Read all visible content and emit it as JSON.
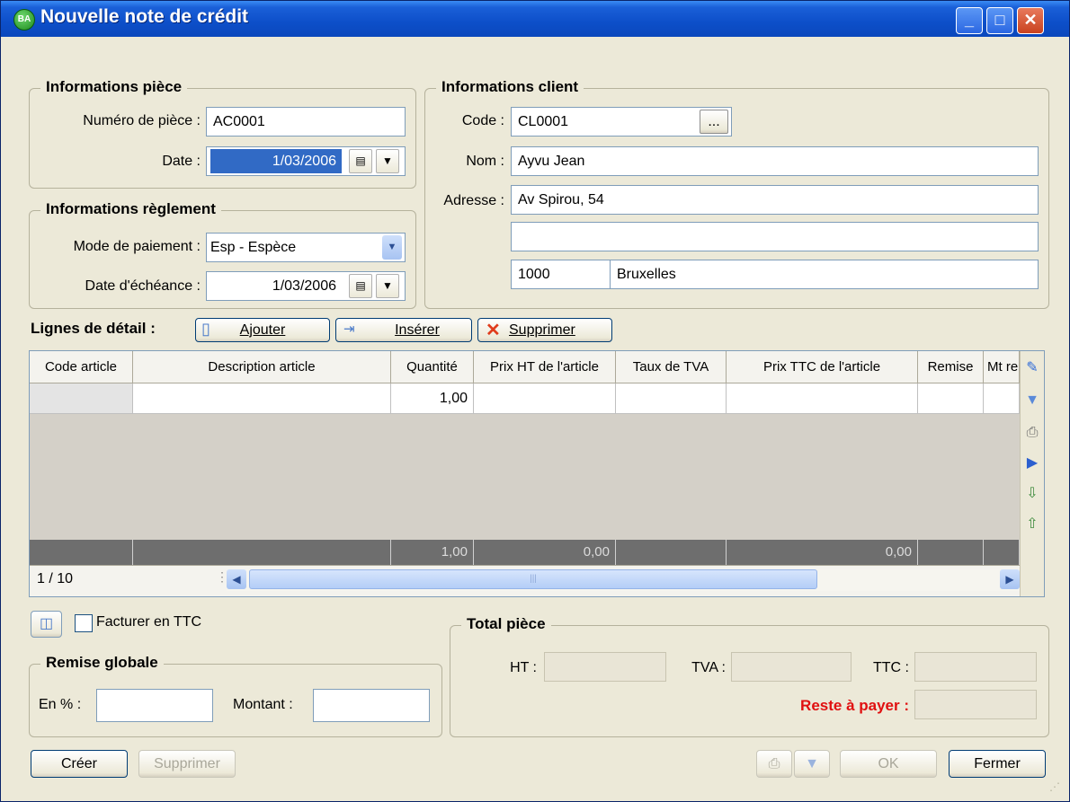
{
  "window": {
    "title": "Nouvelle note de crédit",
    "icon": "app-logo-icon",
    "icon_text": "BA"
  },
  "piece": {
    "title": "Informations pièce",
    "numero_label": "Numéro de pièce :",
    "numero_value": "AC0001",
    "date_label": "Date :",
    "date_value": "1/03/2006"
  },
  "reglement": {
    "title": "Informations règlement",
    "mode_label": "Mode de paiement :",
    "mode_value": "Esp - Espèce",
    "echeance_label": "Date d'échéance :",
    "echeance_value": "1/03/2006"
  },
  "client": {
    "title": "Informations client",
    "code_label": "Code :",
    "code_value": "CL0001",
    "browse_label": "...",
    "nom_label": "Nom :",
    "nom_value": "Ayvu Jean",
    "adresse_label": "Adresse :",
    "adresse1": "Av Spirou, 54",
    "adresse2": "",
    "cp": "1000",
    "ville": "Bruxelles"
  },
  "lignes": {
    "label": "Lignes de détail :",
    "ajouter": "Ajouter",
    "inserer": "Insérer",
    "supprimer": "Supprimer"
  },
  "grid": {
    "columns": [
      "Code article",
      "Description article",
      "Quantité",
      "Prix HT de l'article",
      "Taux de TVA",
      "Prix TTC de l'article",
      "Remise",
      "Mt re"
    ],
    "row": [
      "",
      "",
      "1,00",
      "",
      "",
      "",
      "",
      ""
    ],
    "totals": [
      "",
      "",
      "1,00",
      "0,00",
      "",
      "0,00",
      "",
      ""
    ],
    "pager": "1 / 10"
  },
  "options": {
    "facturer_ttc": "Facturer en TTC",
    "facturer_ttc_checked": false
  },
  "remise": {
    "title": "Remise globale",
    "pct_label": "En % :",
    "pct_value": "",
    "montant_label": "Montant :",
    "montant_value": ""
  },
  "total": {
    "title": "Total pièce",
    "ht_label": "HT :",
    "ht_value": "",
    "tva_label": "TVA :",
    "tva_value": "",
    "ttc_label": "TTC :",
    "ttc_value": "",
    "reste_label": "Reste à payer :",
    "reste_value": "",
    "reste_color": "#e01010"
  },
  "footer": {
    "creer": "Créer",
    "supprimer": "Supprimer",
    "ok": "OK",
    "fermer": "Fermer"
  }
}
